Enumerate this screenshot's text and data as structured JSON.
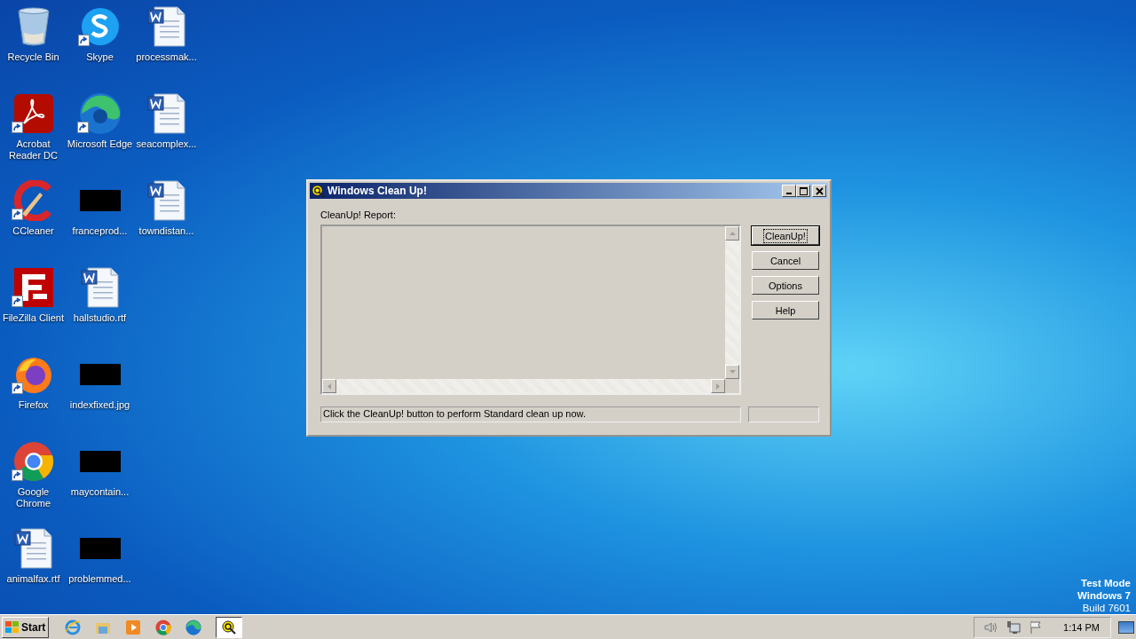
{
  "desktop": {
    "icons": [
      {
        "label": "Recycle Bin",
        "kind": "recycle",
        "shortcut": false
      },
      {
        "label": "Acrobat Reader DC",
        "kind": "acrobat",
        "shortcut": true
      },
      {
        "label": "CCleaner",
        "kind": "ccleaner",
        "shortcut": true
      },
      {
        "label": "FileZilla Client",
        "kind": "filezilla",
        "shortcut": true
      },
      {
        "label": "Firefox",
        "kind": "firefox",
        "shortcut": true
      },
      {
        "label": "Google Chrome",
        "kind": "chrome",
        "shortcut": true
      },
      {
        "label": "animalfax.rtf",
        "kind": "word",
        "shortcut": false
      },
      {
        "label": "Skype",
        "kind": "skype",
        "shortcut": true
      },
      {
        "label": "Microsoft Edge",
        "kind": "edge",
        "shortcut": true
      },
      {
        "label": "franceprod...",
        "kind": "thumb",
        "shortcut": false
      },
      {
        "label": "hallstudio.rtf",
        "kind": "word",
        "shortcut": false
      },
      {
        "label": "indexfixed.jpg",
        "kind": "thumb",
        "shortcut": false
      },
      {
        "label": "maycontain...",
        "kind": "thumb",
        "shortcut": false
      },
      {
        "label": "problemmed...",
        "kind": "thumb",
        "shortcut": false
      },
      {
        "label": "processmak...",
        "kind": "word",
        "shortcut": false
      },
      {
        "label": "seacomplex...",
        "kind": "word",
        "shortcut": false
      },
      {
        "label": "towndistan...",
        "kind": "word",
        "shortcut": false
      }
    ],
    "watermark_os": [
      "Test Mode",
      "Windows 7",
      "Build 7601"
    ]
  },
  "window": {
    "title": "Windows Clean Up!",
    "report_label": "CleanUp! Report:",
    "buttons": [
      {
        "label": "CleanUp!",
        "default": true
      },
      {
        "label": "Cancel",
        "default": false
      },
      {
        "label": "Options",
        "default": false
      },
      {
        "label": "Help",
        "default": false
      }
    ],
    "status_bar": "Click the CleanUp! button to perform Standard clean up now."
  },
  "taskbar": {
    "start": "Start",
    "quick_launch": [
      {
        "kind": "ie"
      },
      {
        "kind": "explorer"
      },
      {
        "kind": "media"
      },
      {
        "kind": "chrome"
      },
      {
        "kind": "edge"
      }
    ],
    "tasks": [
      {
        "kind": "cleanup",
        "selected": true
      }
    ],
    "clock": "1:14 PM"
  }
}
